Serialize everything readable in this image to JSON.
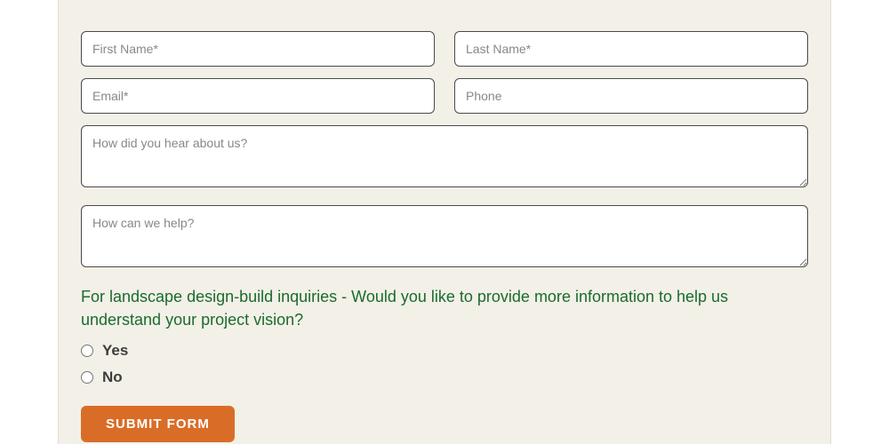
{
  "form": {
    "fields": {
      "first_name": {
        "placeholder": "First Name*"
      },
      "last_name": {
        "placeholder": "Last Name*"
      },
      "email": {
        "placeholder": "Email*"
      },
      "phone": {
        "placeholder": "Phone"
      },
      "hear_about": {
        "placeholder": "How did you hear about us?"
      },
      "help": {
        "placeholder": "How can we help?"
      }
    },
    "question_label": "For landscape design-build inquiries - Would you like to provide more information to help us understand your project vision?",
    "radio_options": {
      "yes": "Yes",
      "no": "No"
    },
    "submit_label": "SUBMIT FORM"
  }
}
